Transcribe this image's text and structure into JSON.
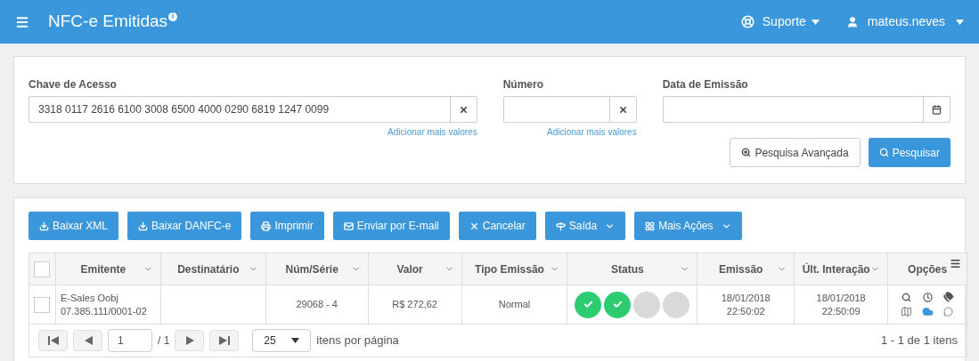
{
  "header": {
    "title": "NFC-e Emitidas",
    "info_mark": "i",
    "support": "Suporte",
    "user": "mateus.neves"
  },
  "filters": [
    {
      "label": "Chave de Acesso",
      "value": "3318 0117 2616 6100 3008 6500 4000 0290 6819 1247 0099",
      "kind": "clearable",
      "link": "Adicionar mais valores"
    },
    {
      "label": "Número",
      "kind": "clearable",
      "link": "Adicionar mais valores"
    },
    {
      "label": "Data de Emissão",
      "kind": "date"
    }
  ],
  "search_buttons": [
    {
      "label": "Pesquisa Avançada",
      "primary": false
    },
    {
      "label": "Pesquisar",
      "primary": true
    }
  ],
  "actions": [
    {
      "label": "Baixar XML",
      "dropdown": false
    },
    {
      "label": "Baixar DANFC-e",
      "dropdown": false
    },
    {
      "label": "Imprimir",
      "dropdown": false
    },
    {
      "label": "Enviar por E-mail",
      "dropdown": false
    },
    {
      "label": "Cancelar",
      "dropdown": false
    },
    {
      "label": "Saída",
      "dropdown": true
    },
    {
      "label": "Mais Ações",
      "dropdown": true
    }
  ],
  "table": {
    "select_all_checked": false,
    "columns": [
      "Emitente",
      "Destinatário",
      "Núm/Série",
      "Valor",
      "Tipo Emissão",
      "Status",
      "Emissão",
      "Últ. Interação",
      "Opções"
    ],
    "rows": [
      {
        "checked": false,
        "emitente": [
          "E-Sales Oobj",
          "07.385.111/0001-02"
        ],
        "num_serie": "29068 - 4",
        "valor": "R$ 272,62",
        "tipo": "Normal",
        "status": [
          {
            "done": true
          },
          {
            "done": true
          },
          {
            "done": false
          },
          {
            "done": false
          }
        ],
        "emissao": [
          "18/01/2018",
          "22:50:02"
        ],
        "ult_interacao": [
          "18/01/2018",
          "22:50:09"
        ]
      }
    ]
  },
  "pager": {
    "page": "1",
    "of": "/ 1",
    "page_size": "25",
    "page_size_label": "itens por página",
    "summary": "1 - 1 de 1 itens"
  }
}
